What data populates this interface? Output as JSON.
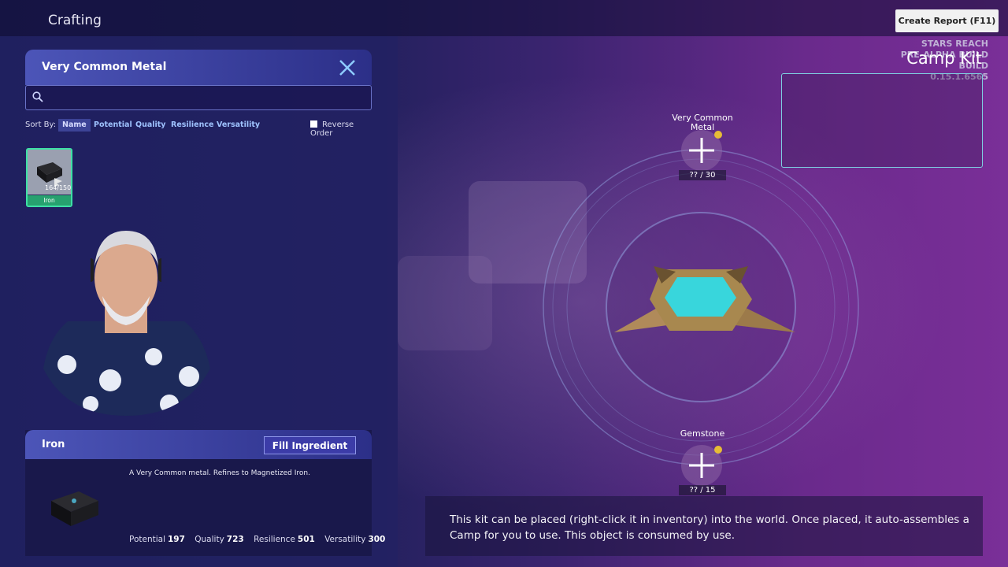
{
  "topbar": {
    "title": "Crafting",
    "report_button": "Create Report (F11)"
  },
  "build": {
    "line1": "STARS REACH",
    "line2": "PRE-ALPHA BUILD",
    "line3": "BUILD 0.15.1.6565"
  },
  "recipe": {
    "title": "Camp Kit"
  },
  "selector": {
    "title": "Very Common Metal",
    "search_placeholder": "",
    "sort_label": "Sort By:",
    "sort_options": [
      "Name",
      "Potential",
      "Quality",
      "Resilience",
      "Versatility"
    ],
    "active_sort": "Name",
    "reverse_label": "Reverse Order",
    "reverse_checked": false,
    "items": [
      {
        "name": "Iron",
        "count": "164/150"
      }
    ]
  },
  "detail": {
    "name": "Iron",
    "fill_button": "Fill Ingredient",
    "description": "A Very Common metal. Refines to Magnetized Iron.",
    "stats": [
      {
        "label": "Potential",
        "value": "197"
      },
      {
        "label": "Quality",
        "value": "723"
      },
      {
        "label": "Resilience",
        "value": "501"
      },
      {
        "label": "Versatility",
        "value": "300"
      }
    ]
  },
  "slots": [
    {
      "label": "Very Common Metal",
      "count": "?? / 30"
    },
    {
      "label": "Gemstone",
      "count": "?? / 15"
    }
  ],
  "recipe_description": "This kit can be placed (right-click it in inventory) into the world. Once placed, it auto-assembles a Camp for you to use. This object is consumed by use.",
  "colors": {
    "accent": "#3de0a5",
    "slot_dot": "#e6bc36",
    "panel_head": "#4c55b8",
    "preview_border": "#7ecfe0"
  }
}
